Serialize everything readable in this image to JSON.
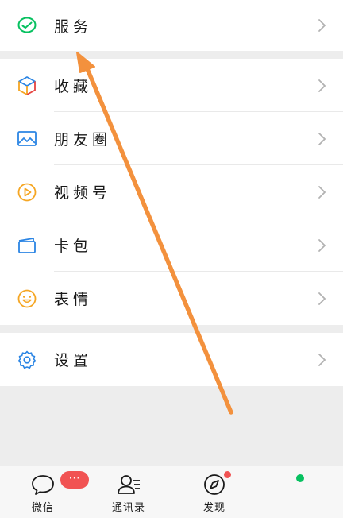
{
  "menu": {
    "service": {
      "label": "服务",
      "icon": "wallet-check-icon"
    },
    "favorites": {
      "label": "收藏",
      "icon": "cube-icon"
    },
    "moments": {
      "label": "朋友圈",
      "icon": "image-icon"
    },
    "channels": {
      "label": "视频号",
      "icon": "play-circle-icon"
    },
    "cards": {
      "label": "卡包",
      "icon": "card-wallet-icon"
    },
    "stickers": {
      "label": "表情",
      "icon": "smiley-icon"
    },
    "settings": {
      "label": "设置",
      "icon": "gear-icon"
    }
  },
  "tabbar": {
    "chats": {
      "label": "微信",
      "badge": "···",
      "icon": "chat-bubble-icon"
    },
    "contacts": {
      "label": "通讯录",
      "icon": "contacts-icon"
    },
    "discover": {
      "label": "发现",
      "icon": "compass-icon"
    },
    "me": {
      "label": "",
      "icon": "me-icon"
    }
  },
  "colors": {
    "accent_green": "#07c160",
    "badge_red": "#f15353",
    "arrow_orange": "#f3913d",
    "icon_blue": "#2b85e4",
    "icon_orange": "#f5a623"
  }
}
